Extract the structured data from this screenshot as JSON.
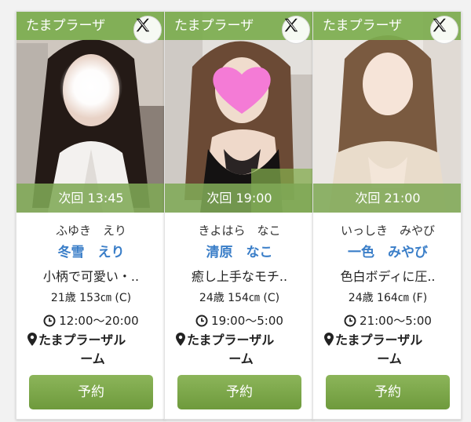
{
  "shop_name": "たまプラーザ",
  "reserve_label": "予約",
  "cards": [
    {
      "next_label": "次回 13:45",
      "kana": "ふゆき　えり",
      "name": "冬雪　えり",
      "catch": "小柄で可愛い・..",
      "spec": "21歳 153㎝ (C)",
      "hours": "12:00〜20:00",
      "place_line1": "たまプラーザル",
      "place_line2": "ーム"
    },
    {
      "next_label": "次回 19:00",
      "kana": "きよはら　なこ",
      "name": "清原　なこ",
      "catch": "癒し上手なモチ..",
      "spec": "24歳 154㎝ (C)",
      "hours": "19:00〜5:00",
      "place_line1": "たまプラーザル",
      "place_line2": "ーム"
    },
    {
      "next_label": "次回 21:00",
      "kana": "いっしき　みやび",
      "name": "一色　みやび",
      "catch": "色白ボディに圧..",
      "spec": "24歳 164㎝ (F)",
      "hours": "21:00〜5:00",
      "place_line1": "たまプラーザル",
      "place_line2": "ーム"
    }
  ],
  "colors": {
    "banner_green": "#7cac4e",
    "name_blue": "#3a7ec8",
    "button_green": "#7aa646"
  },
  "icons": [
    "x-logo-icon",
    "clock-icon",
    "location-pin-icon",
    "heart-sticker-icon"
  ]
}
